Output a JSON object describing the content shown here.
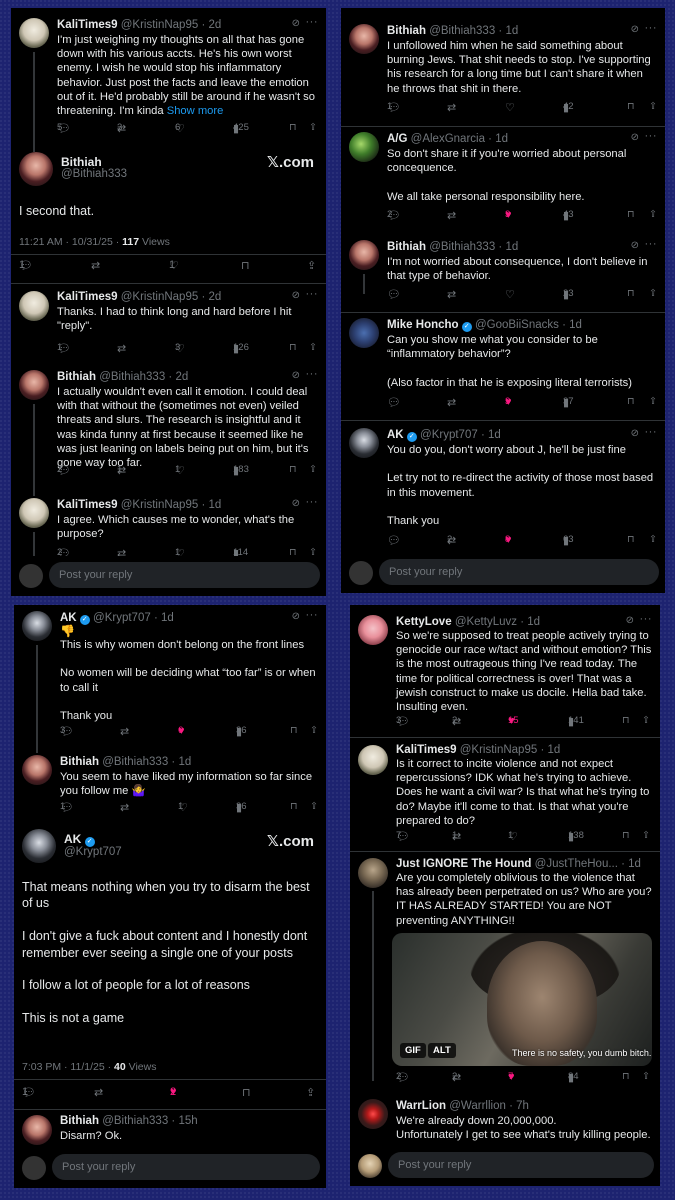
{
  "reply_placeholder": "Post your reply",
  "colors": {
    "like": "#f91880",
    "link": "#1d9bf0",
    "muted": "#71767b",
    "bg": "#000000"
  },
  "panel1": {
    "tweet1": {
      "name": "KaliTimes9",
      "handle": "@KristinNap95",
      "time": "· 2d",
      "text": "I'm just weighing my thoughts on all that has gone down with his various accts. He's his own worst enemy. I wish he would stop his inflammatory behavior. Just post the facts and leave the emotion out of it. He'd probably still be around if he wasn't so threatening. I'm kinda",
      "more": "Show more",
      "replies": "5",
      "reposts": "3",
      "likes": "6",
      "views": "425"
    },
    "main": {
      "name": "Bithiah",
      "handle": "@Bithiah333",
      "brand": "𝕏.com",
      "text": "I second that.",
      "time": "11:21 AM · 10/31/25 ·",
      "views": "117",
      "views_label": "Views",
      "replies": "1",
      "likes": "1"
    },
    "tweet2": {
      "name": "KaliTimes9",
      "handle": "@KristinNap95",
      "time": "· 2d",
      "text": "Thanks. I had to think long and hard before I hit \"reply\".",
      "replies": "1",
      "likes": "3",
      "views": "126"
    },
    "tweet3": {
      "name": "Bithiah",
      "handle": "@Bithiah333",
      "time": "· 2d",
      "text": "I actually wouldn't even call it emotion. I could deal with that without the (sometimes not even) veiled threats and slurs. The research is insightful and it was kinda funny at first because it seemed like he was just leaning on labels being put on him, but it's gone way too far.",
      "replies": "2",
      "reposts": "1",
      "likes": "1",
      "views": "183"
    },
    "tweet4": {
      "name": "KaliTimes9",
      "handle": "@KristinNap95",
      "time": "· 1d",
      "text": "I agree. Which causes me to wonder, what's the purpose?",
      "replies": "2",
      "likes": "1",
      "views": "114"
    }
  },
  "panel2": {
    "tweet1": {
      "name": "Bithiah",
      "handle": "@Bithiah333",
      "time": "· 1d",
      "text": "I unfollowed him when he said something about burning Jews. That shit needs to stop. I've supporting his research for a long time but I can't share it when he throws that shit in there.",
      "replies": "1",
      "views": "42"
    },
    "tweet2": {
      "name": "A/G",
      "handle": "@AlexGnarcia",
      "time": "· 1d",
      "text": "So don't share it if you're worried about personal concequence.\n\nWe all take personal responsibility here.",
      "replies": "2",
      "likes": "3",
      "views": "43"
    },
    "tweet3": {
      "name": "Bithiah",
      "handle": "@Bithiah333",
      "time": "· 1d",
      "text": "I'm not worried about consequence, I don't believe in that type of behavior.",
      "views": "23"
    },
    "tweet4": {
      "name": "Mike Honcho",
      "handle": "@GooBiiSnacks",
      "time": "· 1d",
      "text": "Can you show me what you consider to be “inflammatory behavior”?\n\n(Also factor in that he is exposing literal terrorists)",
      "likes": "3",
      "views": "37"
    },
    "tweet5": {
      "name": "AK",
      "handle": "@Krypt707",
      "time": "· 1d",
      "text": "You do you, don't worry about J, he'll be just fine\n\nLet try not to re-direct the activity of those most based in this movement.\n\nThank you",
      "reposts": "2",
      "likes": "8",
      "views": "63"
    }
  },
  "panel3": {
    "tweet1": {
      "name": "AK",
      "handle": "@Krypt707",
      "time": "· 1d",
      "emoji": "👎",
      "text": "This is why women don't belong on the front lines\n\nNo women will be deciding what “too far” is or when to call it\n\nThank you",
      "replies": "3",
      "likes": "6",
      "views": "36"
    },
    "tweet2": {
      "name": "Bithiah",
      "handle": "@Bithiah333",
      "time": "· 1d",
      "text": "You seem to have liked my information so far since you follow me 🤷‍♀️",
      "replies": "1",
      "likes": "1",
      "views": "36"
    },
    "main": {
      "name": "AK",
      "handle": "@Krypt707",
      "brand": "𝕏.com",
      "text": "That means nothing when you try to disarm the best of us\n\nI don't give a fuck about content and I honestly dont remember ever seeing a single one of your posts\n\nI follow a lot of people for a lot of reasons\n\nThis is not a game",
      "time": "7:03 PM · 11/1/25 ·",
      "views": "40",
      "views_label": "Views",
      "replies": "1",
      "likes": "2"
    },
    "tweet3": {
      "name": "Bithiah",
      "handle": "@Bithiah333",
      "time": "· 15h",
      "text": "Disarm? Ok."
    }
  },
  "panel4": {
    "tweet1": {
      "name": "KettyLove",
      "handle": "@KettyLuvz",
      "time": "· 1d",
      "text": "So we're supposed to treat people actively trying to genocide our race w/tact and without emotion? This is the most outrageous thing I've read today. The time for political correctness is over! That was a jewish construct to make us docile. Hella bad take. Insulting even.",
      "replies": "3",
      "reposts": "2",
      "likes": "15",
      "views": "141"
    },
    "tweet2": {
      "name": "KaliTimes9",
      "handle": "@KristinNap95",
      "time": "· 1d",
      "text": "Is it correct to incite violence and not expect repercussions? IDK what he's trying to achieve. Does he want a civil war? Is that what he's trying to do? Maybe it'll come to that. Is that what you're prepared to do?",
      "replies": "7",
      "reposts": "1",
      "likes": "1",
      "views": "138"
    },
    "tweet3": {
      "name": "Just IGNORE The Hound",
      "handle": "@JustTheHou...",
      "time": "· 1d",
      "text": "Are you completely oblivious to the violence that has already been perpetrated on us? Who are you? IT HAS ALREADY STARTED! You are NOT preventing ANYTHING!!",
      "gif_label": "GIF",
      "alt_label": "ALT",
      "gif_caption": "There is no safety, you dumb bitch.",
      "replies": "2",
      "reposts": "2",
      "likes": "7",
      "views": "84"
    },
    "tweet4": {
      "name": "WarrLion",
      "handle": "@Warrllion",
      "time": "· 7h",
      "text": "We're already down 20,000,000.\nUnfortunately I get to see what's truly killing people."
    }
  }
}
